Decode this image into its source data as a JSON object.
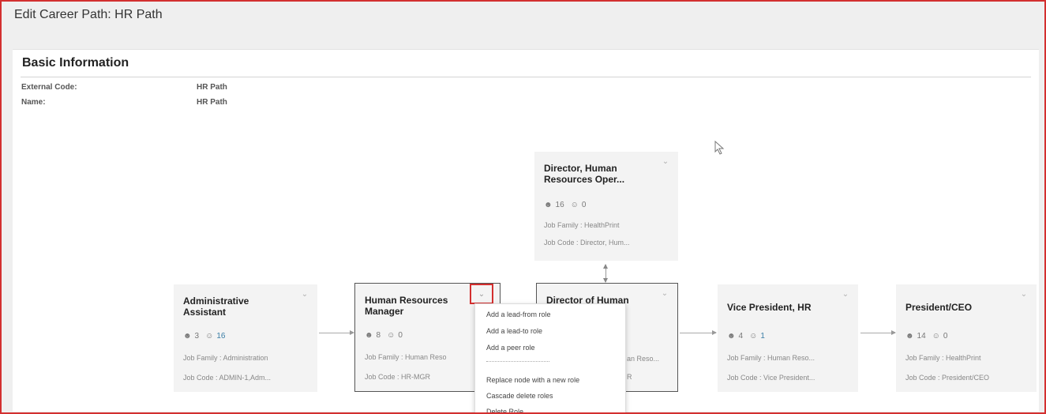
{
  "header": {
    "title": "Edit Career Path: HR Path"
  },
  "basic_info": {
    "title": "Basic Information",
    "fields": [
      {
        "label": "External Code:",
        "value": "HR Path"
      },
      {
        "label": "Name:",
        "value": "HR Path"
      }
    ]
  },
  "cards": {
    "admin": {
      "title": "Administrative Assistant",
      "count_a": "3",
      "count_b": "16",
      "job_family": "Job Family : Administration",
      "job_code": "Job Code : ADMIN-1,Adm..."
    },
    "hrm": {
      "title": "Human Resources Manager",
      "count_a": "8",
      "count_b": "0",
      "job_family": "Job Family : Human Reso",
      "job_code": "Job Code : HR-MGR"
    },
    "dir_hr": {
      "title": "Director of Human",
      "job_family": "an Reso...",
      "job_code": "R"
    },
    "dir_ops": {
      "title": "Director, Human Resources Oper...",
      "count_a": "16",
      "count_b": "0",
      "job_family": "Job Family : HealthPrint",
      "job_code": "Job Code : Director, Hum..."
    },
    "vp": {
      "title": "Vice President, HR",
      "count_a": "4",
      "count_b": "1",
      "job_family": "Job Family : Human Reso...",
      "job_code": "Job Code : Vice President..."
    },
    "ceo": {
      "title": "President/CEO",
      "count_a": "14",
      "count_b": "0",
      "job_family": "Job Family : HealthPrint",
      "job_code": "Job Code : President/CEO"
    }
  },
  "menu": {
    "items": [
      "Add a lead-from role",
      "Add a lead-to role",
      "Add a peer role",
      "Replace node with a new role",
      "Cascade delete roles",
      "Delete Role"
    ]
  }
}
